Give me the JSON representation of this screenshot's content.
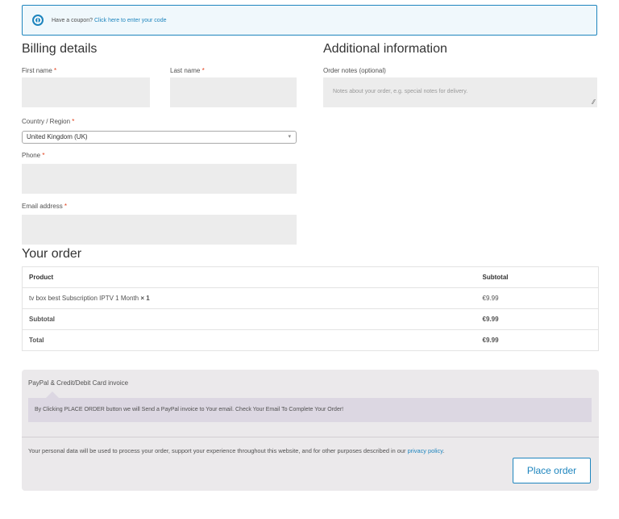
{
  "coupon": {
    "text": "Have a coupon?",
    "link": "Click here to enter your code"
  },
  "billing": {
    "title": "Billing details",
    "first_name_label": "First name",
    "last_name_label": "Last name",
    "country_label": "Country / Region",
    "country_value": "United Kingdom (UK)",
    "phone_label": "Phone",
    "email_label": "Email address",
    "required_mark": "*"
  },
  "additional": {
    "title": "Additional information",
    "notes_label": "Order notes (optional)",
    "notes_placeholder": "Notes about your order, e.g. special notes for delivery."
  },
  "order": {
    "title": "Your order",
    "headers": [
      "Product",
      "Subtotal"
    ],
    "product_name": "tv box best Subscription IPTV 1 Month",
    "product_qty": "× 1",
    "product_price": "€9.99",
    "subtotal_label": "Subtotal",
    "subtotal_value": "€9.99",
    "total_label": "Total",
    "total_value": "€9.99"
  },
  "payment": {
    "method_label": "PayPal & Credit/Debit Card invoice",
    "method_description": "By Clicking PLACE ORDER button we will Send a PayPal invoice to Your email. Check Your Email To Complete Your Order!",
    "privacy_text": "Your personal data will be used to process your order, support your experience throughout this website, and for other purposes described in our",
    "privacy_link": "privacy policy",
    "privacy_end": ".",
    "place_order": "Place order"
  }
}
